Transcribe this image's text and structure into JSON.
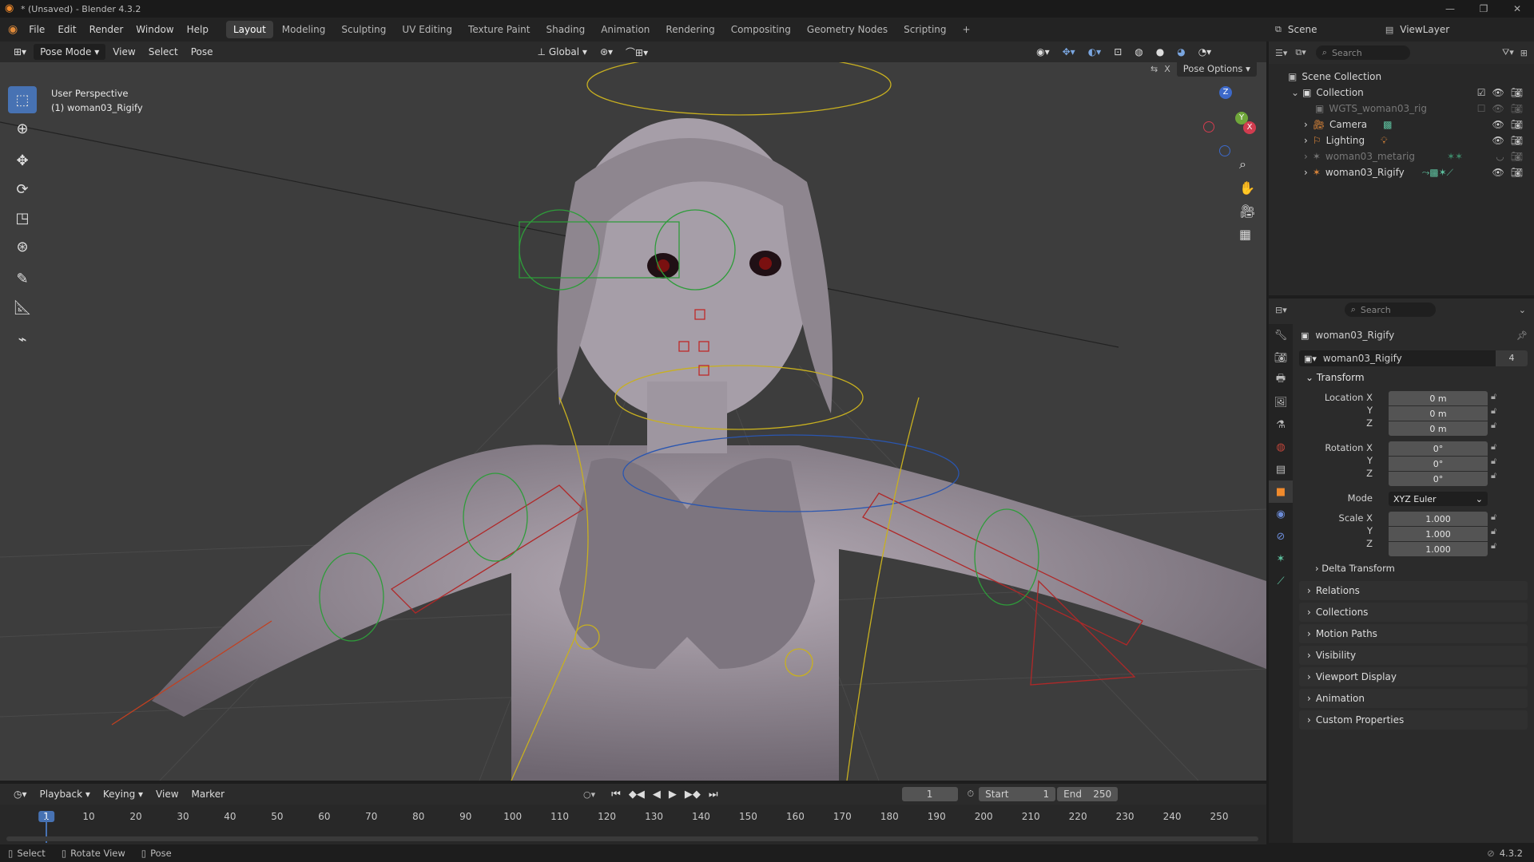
{
  "window": {
    "title": "* (Unsaved) - Blender 4.3.2"
  },
  "menu": {
    "items": [
      "File",
      "Edit",
      "Render",
      "Window",
      "Help"
    ],
    "workspaces": [
      "Layout",
      "Modeling",
      "Sculpting",
      "UV Editing",
      "Texture Paint",
      "Shading",
      "Animation",
      "Rendering",
      "Compositing",
      "Geometry Nodes",
      "Scripting"
    ],
    "active_workspace": "Layout",
    "add_tab": "+",
    "scene_label": "Scene",
    "viewlayer_label": "ViewLayer"
  },
  "viewport_header": {
    "mode": "Pose Mode",
    "menus": [
      "View",
      "Select",
      "Pose"
    ],
    "orientation": "Global",
    "pose_options": "Pose Options"
  },
  "viewport": {
    "perspective": "User Perspective",
    "object_label": "(1) woman03_Rigify",
    "gizmo_axes": [
      "Z",
      "Y",
      "X"
    ]
  },
  "outliner": {
    "search_placeholder": "Search",
    "root": "Scene Collection",
    "collection": "Collection",
    "items": [
      {
        "name": "WGTS_woman03_rig",
        "dim": true
      },
      {
        "name": "Camera",
        "dim": false
      },
      {
        "name": "Lighting",
        "dim": false
      },
      {
        "name": "woman03_metarig",
        "dim": true
      },
      {
        "name": "woman03_Rigify",
        "dim": false
      }
    ]
  },
  "properties": {
    "search_placeholder": "Search",
    "object_name": "woman03_Rigify",
    "datablock_name": "woman03_Rigify",
    "user_count": "4",
    "transform_header": "Transform",
    "location_label": "Location X",
    "location": [
      "0 m",
      "0 m",
      "0 m"
    ],
    "rotation_label": "Rotation X",
    "rotation": [
      "0°",
      "0°",
      "0°"
    ],
    "mode_label": "Mode",
    "mode_value": "XYZ Euler",
    "scale_label": "Scale X",
    "scale": [
      "1.000",
      "1.000",
      "1.000"
    ],
    "axis_y": "Y",
    "axis_z": "Z",
    "delta_transform": "Delta Transform",
    "panels": [
      "Relations",
      "Collections",
      "Motion Paths",
      "Visibility",
      "Viewport Display",
      "Animation",
      "Custom Properties"
    ]
  },
  "timeline": {
    "menus": [
      "Playback",
      "Keying",
      "View",
      "Marker"
    ],
    "current_frame": "1",
    "start_label": "Start",
    "start": "1",
    "end_label": "End",
    "end": "250",
    "ticks": [
      "1",
      "10",
      "20",
      "30",
      "40",
      "50",
      "60",
      "70",
      "80",
      "90",
      "100",
      "110",
      "120",
      "130",
      "140",
      "150",
      "160",
      "170",
      "180",
      "190",
      "200",
      "210",
      "220",
      "230",
      "240",
      "250"
    ]
  },
  "statusbar": {
    "items": [
      "Select",
      "Rotate View",
      "Pose"
    ],
    "version": "4.3.2"
  }
}
